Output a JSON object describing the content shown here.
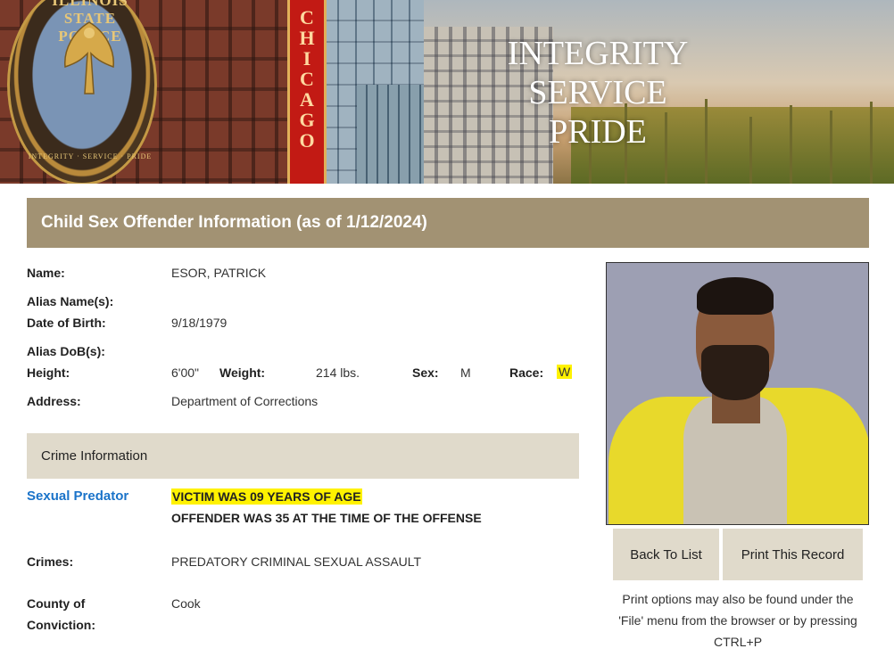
{
  "banner": {
    "seal_top_text": "ILLINOIS STATE POLICE",
    "seal_bottom_text": "INTEGRITY · SERVICE · PRIDE",
    "sign_letters": [
      "C",
      "H",
      "I",
      "C",
      "A",
      "G",
      "O"
    ],
    "motto": [
      "INTEGRITY",
      "SERVICE",
      "PRIDE"
    ]
  },
  "header": {
    "title": "Child Sex Offender Information (as of 1/12/2024)"
  },
  "offender": {
    "name_label": "Name:",
    "name": "ESOR, PATRICK",
    "alias_names_label": "Alias Name(s):",
    "alias_names": "",
    "dob_label": "Date of Birth:",
    "dob": "9/18/1979",
    "alias_dob_label": "Alias DoB(s):",
    "alias_dob": "",
    "height_label": "Height:",
    "height": "6'00\"",
    "weight_label": "Weight:",
    "weight": "214 lbs.",
    "sex_label": "Sex:",
    "sex": "M",
    "race_label": "Race:",
    "race": "W",
    "address_label": "Address:",
    "address": "Department of Corrections"
  },
  "crime": {
    "section_title": "Crime Information",
    "status_link": "Sexual Predator",
    "victim_age": "VICTIM WAS 09 YEARS OF AGE",
    "offender_age": "OFFENDER WAS 35 AT THE TIME OF THE OFFENSE",
    "crimes_label": "Crimes:",
    "crimes": "PREDATORY CRIMINAL SEXUAL ASSAULT",
    "county_label_1": "County of",
    "county_label_2": "Conviction:",
    "county": "Cook"
  },
  "actions": {
    "back_label": "Back To List",
    "print_label": "Print This Record",
    "print_note": "Print options may also be found under the 'File' menu from the browser or by pressing CTRL+P"
  },
  "colors": {
    "header_bar": "#a29273",
    "section_bar": "#e0dacb",
    "link": "#1a73c9",
    "highlight": "#fff200"
  }
}
